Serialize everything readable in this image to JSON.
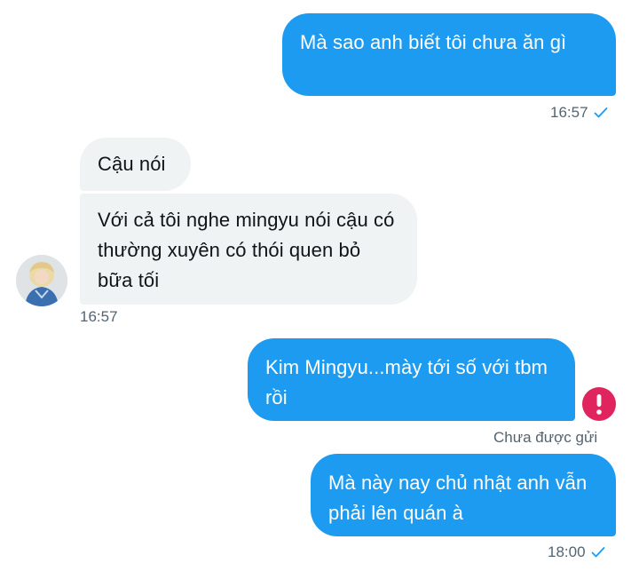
{
  "messages": [
    {
      "text": "Mà sao anh biết tôi chưa ăn gì",
      "direction": "outgoing"
    },
    {
      "text": "Cậu nói",
      "direction": "incoming"
    },
    {
      "text": "Với cả tôi nghe mingyu nói cậu có thường xuyên có thói quen bỏ bữa tối",
      "direction": "incoming"
    },
    {
      "text": "Kim Mingyu...mày tới số với tbm rồi",
      "direction": "outgoing"
    },
    {
      "text": "Mà này nay chủ nhật anh vẫn phải lên quán à",
      "direction": "outgoing"
    }
  ],
  "timestamps": {
    "t1": "16:57",
    "t2": "16:57",
    "t3": "18:00"
  },
  "status": {
    "not_sent": "Chưa được gửi"
  },
  "icons": {
    "read_receipt": "check-icon",
    "error": "exclamation-icon",
    "avatar": "avatar"
  },
  "colors": {
    "outgoing_bubble": "#1d9bf0",
    "incoming_bubble": "#eff3f4",
    "error": "#e0245e",
    "meta_text": "#536471"
  }
}
